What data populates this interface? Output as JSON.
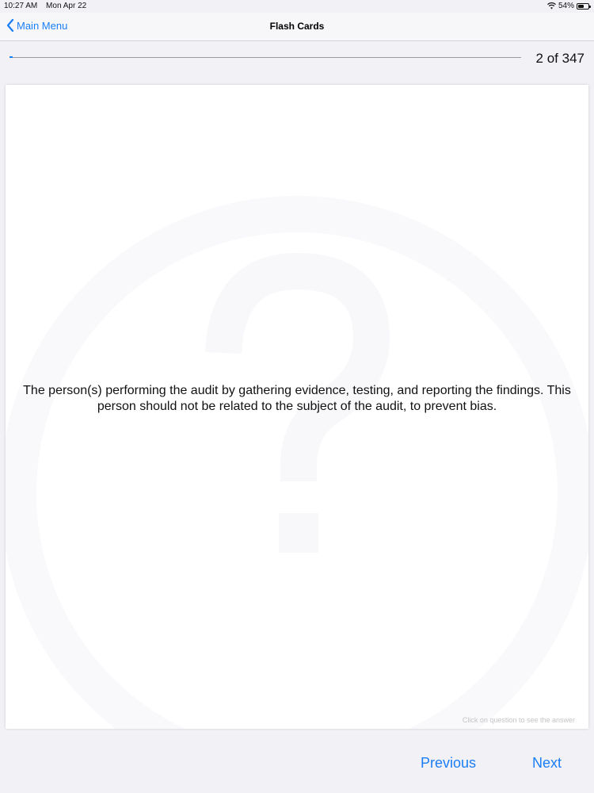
{
  "status_bar": {
    "time": "10:27 AM",
    "date": "Mon Apr 22",
    "battery": "54%",
    "icons": [
      "wifi-icon",
      "battery-icon"
    ]
  },
  "nav": {
    "back_label": "Main Menu",
    "title": "Flash Cards",
    "back_icon": "chevron-left-icon"
  },
  "progress": {
    "label": "2 of 347",
    "current": 2,
    "total": 347
  },
  "card": {
    "text": "The person(s) performing the audit by gathering evidence, testing, and reporting the findings. This person should not be related to the subject of the audit, to prevent bias.",
    "hint": "Click on question to see the answer",
    "watermark_icon": "question-circle-icon"
  },
  "buttons": {
    "previous": "Previous",
    "next": "Next"
  },
  "colors": {
    "accent": "#1a7ef5",
    "background": "#f2f1f6"
  }
}
